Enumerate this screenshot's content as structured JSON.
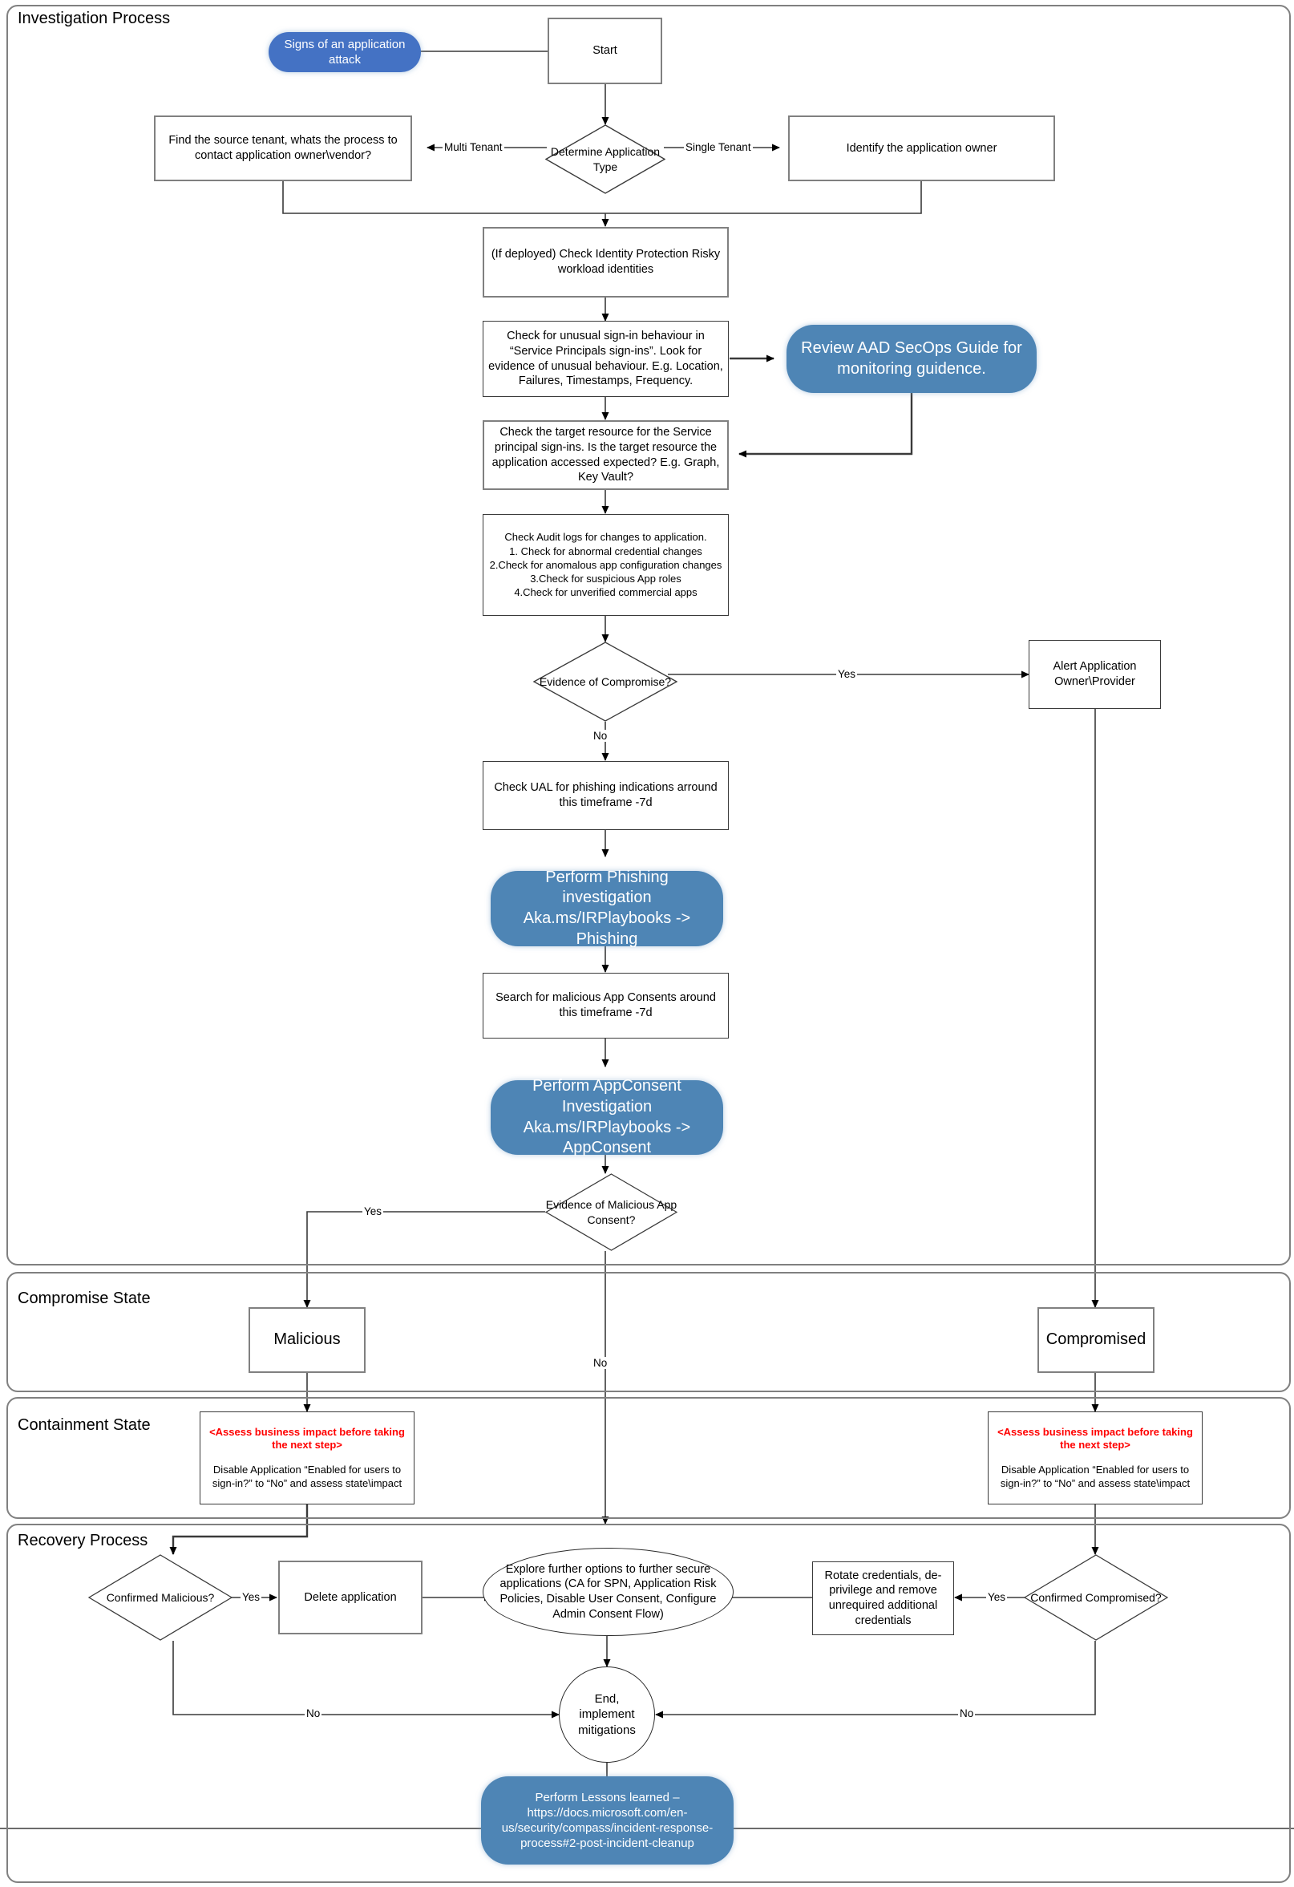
{
  "lanes": [
    {
      "id": "investigation",
      "title": "Investigation Process"
    },
    {
      "id": "compromise",
      "title": "Compromise State"
    },
    {
      "id": "containment",
      "title": "Containment State"
    },
    {
      "id": "recovery",
      "title": "Recovery Process"
    }
  ],
  "nodes": {
    "signs": "Signs of an application attack",
    "start": "Start",
    "determine_type": "Determine Application Type",
    "find_tenant": "Find the source tenant, whats the process to contact application owner\\vendor?",
    "identify_owner": "Identify the application owner",
    "risky_identities": "(If deployed) Check Identity Protection Risky workload identities",
    "unusual_signin": "Check for unusual sign-in behaviour in “Service Principals sign-ins”. Look for evidence of unusual behaviour. E.g. Location, Failures, Timestamps, Frequency.",
    "secops_guide": "Review AAD SecOps Guide for monitoring guidence.",
    "target_resource": "Check the target resource for the Service principal sign-ins. Is the target resource the application accessed expected? E.g. Graph, Key Vault?",
    "audit_logs_title": "Check Audit logs for changes to application.",
    "audit_logs_items": [
      "1. Check for abnormal credential changes",
      "2.Check for anomalous app configuration changes",
      "3.Check for suspicious App roles",
      "4.Check for unverified commercial apps"
    ],
    "evidence_compromise": "Evidence of Compromise?",
    "alert_owner": "Alert Application Owner\\Provider",
    "check_ual": "Check UAL for phishing indications arround this timeframe -7d",
    "perform_phishing": "Perform Phishing investigation Aka.ms/IRPlaybooks -> Phishing",
    "search_consents": "Search for malicious App Consents around this timeframe -7d",
    "perform_appconsent": "Perform AppConsent Investigation Aka.ms/IRPlaybooks -> AppConsent",
    "evidence_consent": "Evidence of Malicious App Consent?",
    "malicious": "Malicious",
    "compromised": "Compromised",
    "containment_warn": "<Assess business impact before taking the next step>",
    "containment_action": "Disable Application “Enabled for users to sign-in?” to “No” and assess state\\impact",
    "confirmed_malicious": "Confirmed Malicious?",
    "delete_application": "Delete application",
    "explore_options": "Explore further options to further secure applications (CA for SPN, Application Risk Policies, Disable User Consent, Configure Admin Consent Flow)",
    "rotate_credentials": "Rotate credentials, de-privilege and remove unrequired additional credentials",
    "confirmed_compromised": "Confirmed Compromised?",
    "end_node": "End, implement mitigations",
    "lessons_learned": "Perform Lessons learned – https://docs.microsoft.com/en-us/security/compass/incident-response-process#2-post-incident-cleanup"
  },
  "edge_labels": {
    "multi_tenant": "Multi Tenant",
    "single_tenant": "Single Tenant",
    "yes_compromise": "Yes",
    "no_compromise": "No",
    "yes_consent": "Yes",
    "no_consent": "No",
    "yes_malicious": "Yes",
    "no_malicious": "No",
    "yes_compromised": "Yes",
    "no_compromised": "No"
  },
  "colors": {
    "pill_blue": "#4e85b5",
    "start_blue": "#4472c4",
    "warning_red": "#ff0000",
    "box_border": "#808080",
    "lane_border": "#808080"
  }
}
